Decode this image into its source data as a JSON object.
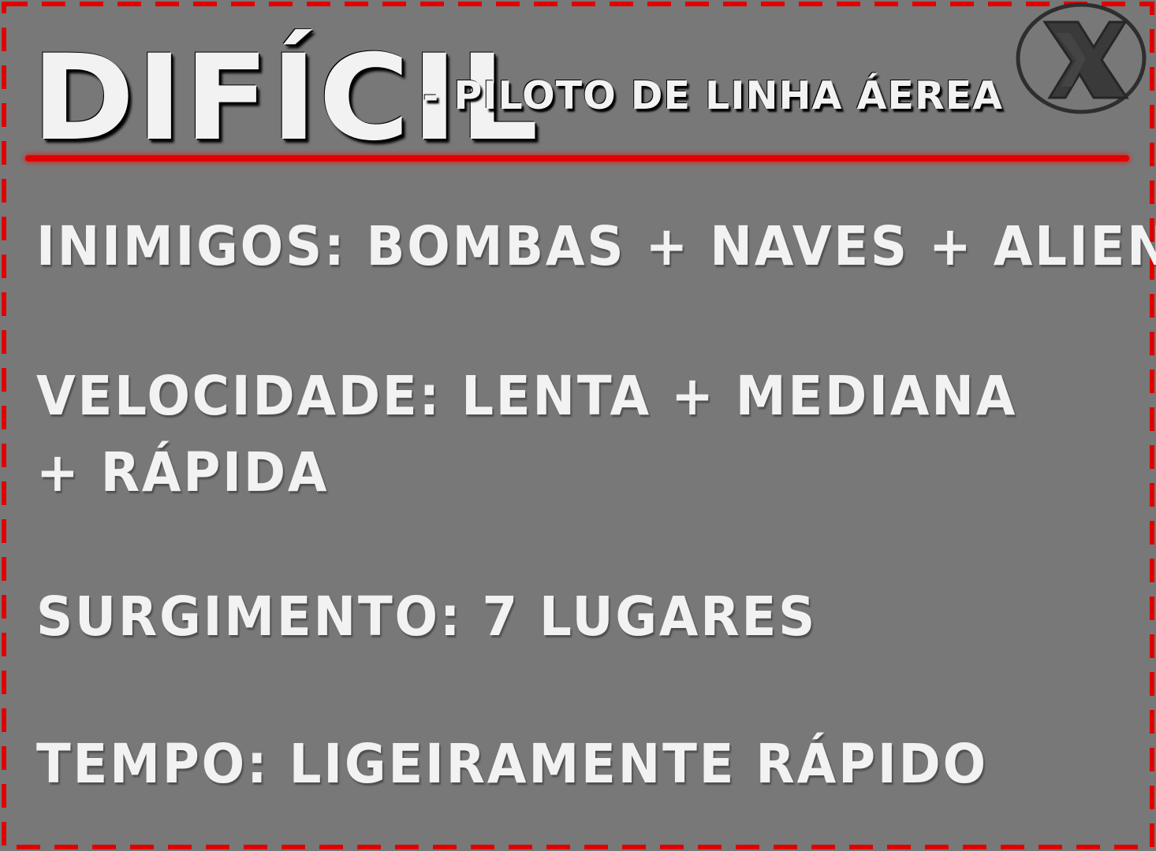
{
  "card": {
    "title": "DIFÍCIL",
    "subtitle": "- PILOTO DE LINHA ÁEREA",
    "close_icon": "x-circle-icon",
    "lines": [
      "INIMIGOS: BOMBAS + NAVES + ALIENS",
      "VELOCIDADE: LENTA + MEDIANA",
      "+ RÁPIDA",
      "SURGIMENTO: 7 LUGARES",
      "TEMPO: LIGEIRAMENTE RÁPIDO"
    ]
  },
  "colors": {
    "background": "#787878",
    "border": "#e00000",
    "text": "#f2f2f2",
    "accent_line": "#e00000",
    "logo": "#3a3a3a"
  }
}
